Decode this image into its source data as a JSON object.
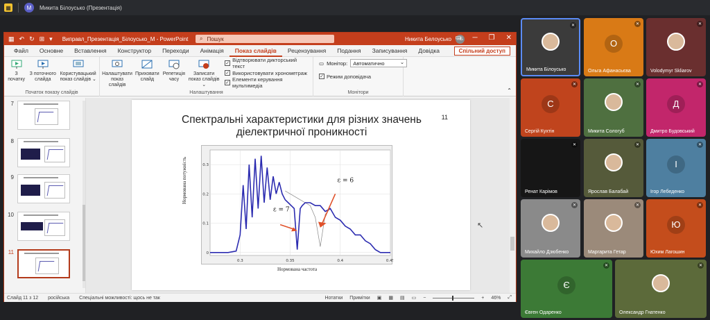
{
  "meeting": {
    "app_icon": "teams-app-icon",
    "avatar_initial": "M",
    "title": "Микита Білоусько (Презентація)"
  },
  "ppt": {
    "doc_title": "Виправл_Презентація_Білоусько_М  -  PowerPoint",
    "search_placeholder": "Пошук",
    "user_name": "Никита Белоусько",
    "user_initials": "НБ",
    "tabs": [
      "Файл",
      "Основне",
      "Вставлення",
      "Конструктор",
      "Переходи",
      "Анімація",
      "Показ слайдів",
      "Рецензування",
      "Подання",
      "Записування",
      "Довідка"
    ],
    "active_tab": "Показ слайдів",
    "share_label": "Спільний доступ",
    "ribbon": {
      "from_start": "З початку",
      "from_current": "З поточного слайда",
      "custom_show": "Користувацький показ слайдів ⌄",
      "group_start": "Початок показу слайдів",
      "setup_show": "Налаштувати показ слайдів",
      "hide_slide": "Приховати слайд",
      "rehearse": "Репетиція часу",
      "record": "Записати показ слайдів ⌄",
      "chk_narration": "Відтворювати дикторський текст",
      "chk_timings": "Використовувати хронометраж",
      "chk_media": "Елементи керування мультимедіа",
      "group_setup": "Налаштування",
      "monitor_label": "Монітор:",
      "monitor_value": "Автоматично",
      "presenter_view": "Режим доповідача",
      "group_monitors": "Монітори"
    },
    "thumbnails": [
      {
        "num": "7"
      },
      {
        "num": "8"
      },
      {
        "num": "9"
      },
      {
        "num": "10"
      },
      {
        "num": "11"
      }
    ],
    "slide": {
      "title_line1": "Спектральні характеристики для різних значень",
      "title_line2": "діелектричної проникності",
      "number": "11",
      "ylabel": "Нормована потужність",
      "xlabel": "Нормована частота",
      "annot_eps7": "ε = 7",
      "annot_eps6": "ε = 6",
      "yticks": [
        "0.3",
        "0.2",
        "0.1",
        "0"
      ],
      "xticks": [
        "0.3",
        "0.35",
        "0.4",
        "0.45"
      ]
    },
    "status": {
      "slide_pos": "Слайд 11 з 12",
      "language": "російська",
      "accessibility": "Спеціальні можливості: щось не так",
      "notes": "Нотатки",
      "comments": "Примітки",
      "zoom": "46%"
    }
  },
  "chart_data": {
    "type": "line",
    "title": "",
    "xlabel": "Нормована частота",
    "ylabel": "Нормована потужність",
    "xlim": [
      0.27,
      0.45
    ],
    "ylim": [
      -0.01,
      0.35
    ],
    "xticks": [
      0.3,
      0.35,
      0.4,
      0.45
    ],
    "yticks": [
      0,
      0.1,
      0.2,
      0.3
    ],
    "grid": true,
    "series": [
      {
        "name": "ε = 7",
        "color": "#2b2bb0",
        "x": [
          0.27,
          0.288,
          0.296,
          0.3,
          0.303,
          0.306,
          0.309,
          0.312,
          0.315,
          0.318,
          0.321,
          0.324,
          0.327,
          0.33,
          0.333,
          0.336,
          0.339,
          0.342,
          0.345,
          0.348,
          0.351,
          0.354,
          0.357,
          0.36,
          0.362,
          0.365,
          0.37,
          0.375,
          0.38,
          0.385,
          0.39,
          0.395,
          0.4,
          0.405,
          0.41,
          0.415,
          0.42,
          0.425,
          0.43,
          0.435,
          0.44,
          0.45
        ],
        "y": [
          0.0,
          0.0,
          0.005,
          0.06,
          0.23,
          0.08,
          0.3,
          0.12,
          0.32,
          0.15,
          0.33,
          0.17,
          0.29,
          0.18,
          0.26,
          0.2,
          0.24,
          0.2,
          0.18,
          0.17,
          0.16,
          0.15,
          0.01,
          0.15,
          0.16,
          0.17,
          0.17,
          0.16,
          0.16,
          0.14,
          0.15,
          0.12,
          0.11,
          0.09,
          0.08,
          0.06,
          0.06,
          0.04,
          0.03,
          0.01,
          0.0,
          0.0
        ]
      },
      {
        "name": "ε = 6",
        "color": "#888888",
        "x": [
          0.345,
          0.35,
          0.355,
          0.36,
          0.365,
          0.37,
          0.375,
          0.38,
          0.385,
          0.39,
          0.395,
          0.4
        ],
        "y": [
          0.21,
          0.2,
          0.19,
          0.18,
          0.17,
          0.16,
          0.12,
          0.02,
          0.13,
          0.15,
          0.12,
          0.11
        ]
      }
    ]
  },
  "participants": [
    {
      "name": "Микита Білоусько",
      "kind": "video",
      "color": "#3b3b3b",
      "active": true
    },
    {
      "name": "Ольга Афанасьєва",
      "kind": "letter",
      "letter": "О",
      "color": "#d97a16"
    },
    {
      "name": "Volodymyr Skliarov",
      "kind": "video",
      "color": "#6a2f2f"
    },
    {
      "name": "Сергій Кухтін",
      "kind": "letter",
      "letter": "С",
      "color": "#c0441d"
    },
    {
      "name": "Микита Сологуб",
      "kind": "video",
      "color": "#4f7040"
    },
    {
      "name": "Дмитро Будовський",
      "kind": "letter",
      "letter": "Д",
      "color": "#c2266b"
    },
    {
      "name": "Ренат Карімов",
      "kind": "dark",
      "color": "#161616"
    },
    {
      "name": "Ярослав Балабай",
      "kind": "video",
      "color": "#555a3a"
    },
    {
      "name": "Ігор Лебеденко",
      "kind": "letter",
      "letter": "І",
      "color": "#4e7fa0"
    },
    {
      "name": "Михайло Дзюбенко",
      "kind": "video",
      "color": "#8a8a8a"
    },
    {
      "name": "Маргарита Гетар",
      "kind": "video",
      "color": "#9b8a7a"
    },
    {
      "name": "Юхим Лагошин",
      "kind": "letter",
      "letter": "Ю",
      "color": "#c44d1c"
    },
    {
      "name": "Євген Одаренко",
      "kind": "letter",
      "letter": "Є",
      "color": "#3c7a36"
    },
    {
      "name": "Олександр Гнатенко",
      "kind": "video",
      "color": "#5c6a3a"
    }
  ]
}
